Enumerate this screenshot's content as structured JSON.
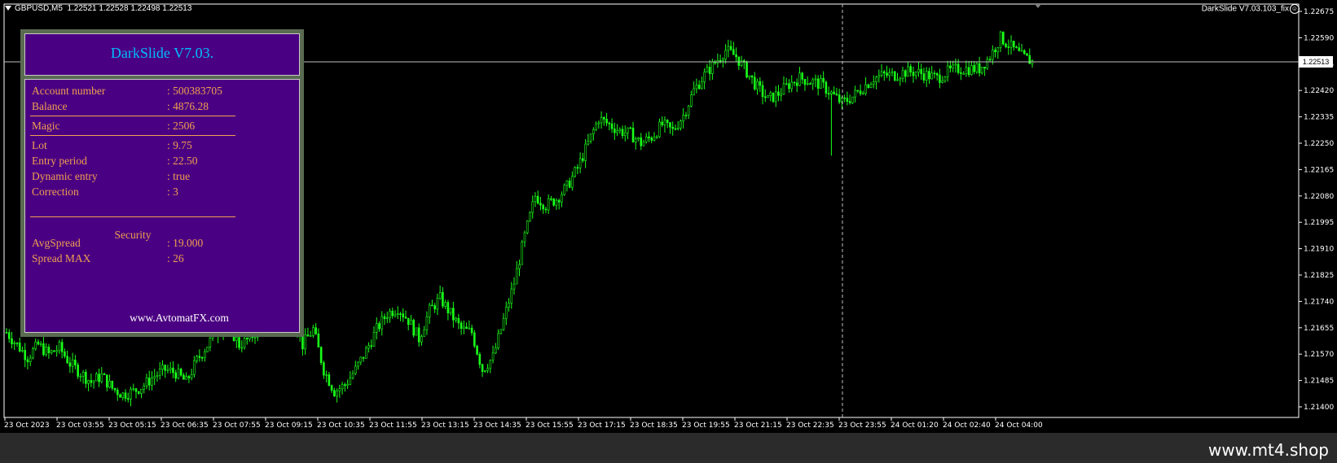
{
  "chart_header": {
    "symbol": "GBPUSD,M5",
    "open": "1.22521",
    "high": "1.22528",
    "low": "1.22498",
    "close": "1.22513"
  },
  "expert_label": "DarkSlide V7.03.103_fix",
  "current_price": "1.22513",
  "panel": {
    "title": "DarkSlide V7.03.",
    "rows_top": [
      {
        "label": "Account number",
        "value": ": 500383705"
      },
      {
        "label": "Balance",
        "value": ": 4876.28"
      }
    ],
    "rows_magic": [
      {
        "label": "Magic",
        "value": ": 2506"
      }
    ],
    "rows_params": [
      {
        "label": "Lot",
        "value": ": 9.75"
      },
      {
        "label": "Entry period",
        "value": ": 22.50"
      },
      {
        "label": "Dynamic entry",
        "value": ": true"
      },
      {
        "label": "Correction",
        "value": ": 3"
      }
    ],
    "security_title": "Security",
    "rows_security": [
      {
        "label": "AvgSpread",
        "value": ": 19.000"
      },
      {
        "label": "Spread MAX",
        "value": ": 26"
      }
    ],
    "website": "www.AvtomatFX.com"
  },
  "watermark": "www.mt4.shop",
  "colors": {
    "candle": "#19ff19",
    "panel_bg": "#4a0082",
    "panel_text": "#f0a050",
    "panel_title": "#00bfff"
  },
  "chart_data": {
    "type": "candlestick",
    "symbol": "GBPUSD",
    "timeframe": "M5",
    "y_ticks": [
      "1.22675",
      "1.22590",
      "1.22505",
      "1.22420",
      "1.22335",
      "1.22250",
      "1.22165",
      "1.22080",
      "1.21995",
      "1.21910",
      "1.21825",
      "1.21740",
      "1.21655",
      "1.21570",
      "1.21485",
      "1.21400"
    ],
    "x_ticks": [
      "23 Oct 2023",
      "23 Oct 03:55",
      "23 Oct 05:15",
      "23 Oct 06:35",
      "23 Oct 07:55",
      "23 Oct 09:15",
      "23 Oct 10:35",
      "23 Oct 11:55",
      "23 Oct 13:15",
      "23 Oct 14:35",
      "23 Oct 15:55",
      "23 Oct 17:15",
      "23 Oct 18:35",
      "23 Oct 19:55",
      "23 Oct 21:15",
      "23 Oct 22:35",
      "23 Oct 23:55",
      "24 Oct 01:20",
      "24 Oct 02:40",
      "24 Oct 04:00"
    ],
    "ylim": [
      1.214,
      1.2269
    ],
    "close_path": [
      [
        0,
        1.2164
      ],
      [
        4,
        1.216
      ],
      [
        8,
        1.2156
      ],
      [
        12,
        1.216
      ],
      [
        16,
        1.2157
      ],
      [
        20,
        1.2159
      ],
      [
        24,
        1.2154
      ],
      [
        28,
        1.2151
      ],
      [
        32,
        1.2148
      ],
      [
        36,
        1.215
      ],
      [
        40,
        1.2146
      ],
      [
        44,
        1.2144
      ],
      [
        48,
        1.2145
      ],
      [
        52,
        1.2147
      ],
      [
        56,
        1.215
      ],
      [
        60,
        1.2152
      ],
      [
        64,
        1.2151
      ],
      [
        68,
        1.2148
      ],
      [
        72,
        1.2155
      ],
      [
        76,
        1.216
      ],
      [
        80,
        1.2165
      ],
      [
        84,
        1.2166
      ],
      [
        88,
        1.216
      ],
      [
        92,
        1.2162
      ],
      [
        96,
        1.2166
      ],
      [
        100,
        1.2174
      ],
      [
        104,
        1.2178
      ],
      [
        108,
        1.217
      ],
      [
        112,
        1.216
      ],
      [
        116,
        1.2165
      ],
      [
        120,
        1.2152
      ],
      [
        124,
        1.2145
      ],
      [
        128,
        1.2147
      ],
      [
        132,
        1.2152
      ],
      [
        136,
        1.2158
      ],
      [
        140,
        1.2165
      ],
      [
        144,
        1.217
      ],
      [
        148,
        1.2172
      ],
      [
        152,
        1.2168
      ],
      [
        156,
        1.2162
      ],
      [
        160,
        1.2171
      ],
      [
        164,
        1.2175
      ],
      [
        168,
        1.217
      ],
      [
        172,
        1.2165
      ],
      [
        176,
        1.2164
      ],
      [
        180,
        1.2152
      ],
      [
        184,
        1.2156
      ],
      [
        188,
        1.2168
      ],
      [
        192,
        1.218
      ],
      [
        196,
        1.2195
      ],
      [
        200,
        1.2208
      ],
      [
        204,
        1.2205
      ],
      [
        208,
        1.2207
      ],
      [
        212,
        1.2211
      ],
      [
        216,
        1.2217
      ],
      [
        220,
        1.2225
      ],
      [
        224,
        1.2233
      ],
      [
        228,
        1.2231
      ],
      [
        232,
        1.2229
      ],
      [
        236,
        1.2228
      ],
      [
        240,
        1.2225
      ],
      [
        244,
        1.2227
      ],
      [
        248,
        1.2231
      ],
      [
        252,
        1.2229
      ],
      [
        256,
        1.2234
      ],
      [
        260,
        1.2242
      ],
      [
        264,
        1.2247
      ],
      [
        268,
        1.2251
      ],
      [
        272,
        1.2255
      ],
      [
        276,
        1.2253
      ],
      [
        280,
        1.2248
      ],
      [
        284,
        1.2243
      ],
      [
        288,
        1.2239
      ],
      [
        292,
        1.2241
      ],
      [
        296,
        1.2244
      ],
      [
        300,
        1.2246
      ],
      [
        304,
        1.2245
      ],
      [
        308,
        1.2244
      ],
      [
        312,
        1.2241
      ],
      [
        316,
        1.2238
      ],
      [
        320,
        1.224
      ],
      [
        324,
        1.2243
      ],
      [
        328,
        1.2246
      ],
      [
        332,
        1.2247
      ],
      [
        336,
        1.2247
      ],
      [
        340,
        1.2248
      ],
      [
        344,
        1.2248
      ],
      [
        348,
        1.2247
      ],
      [
        352,
        1.2246
      ],
      [
        356,
        1.2248
      ],
      [
        360,
        1.2249
      ],
      [
        364,
        1.2249
      ],
      [
        368,
        1.2249
      ],
      [
        372,
        1.2253
      ],
      [
        376,
        1.2259
      ],
      [
        380,
        1.2256
      ],
      [
        384,
        1.2253
      ],
      [
        388,
        1.22513
      ]
    ]
  }
}
